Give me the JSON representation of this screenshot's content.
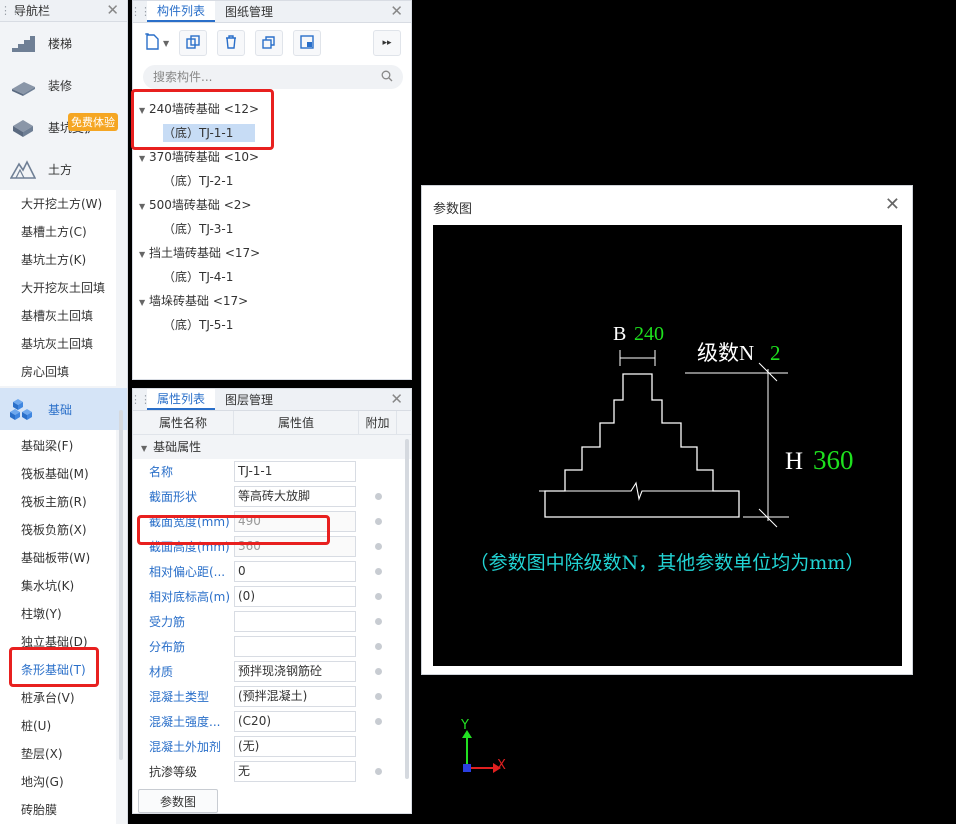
{
  "nav": {
    "title": "导航栏",
    "categories_top": [
      {
        "label": "楼梯",
        "icon": "stairs-icon"
      },
      {
        "label": "装修",
        "icon": "decoration-icon"
      },
      {
        "label": "基坑支护",
        "icon": "pit-support-icon"
      },
      {
        "label": "土方",
        "icon": "earthwork-icon"
      }
    ],
    "promo_badge": "免费体验",
    "earthwork_items": [
      "大开挖土方(W)",
      "基槽土方(C)",
      "基坑土方(K)",
      "大开挖灰土回填",
      "基槽灰土回填",
      "基坑灰土回填",
      "房心回填"
    ],
    "foundation_category": "基础",
    "foundation_items": [
      "基础梁(F)",
      "筏板基础(M)",
      "筏板主筋(R)",
      "筏板负筋(X)",
      "基础板带(W)",
      "集水坑(K)",
      "柱墩(Y)",
      "独立基础(D)",
      "条形基础(T)",
      "桩承台(V)",
      "桩(U)",
      "垫层(X)",
      "地沟(G)",
      "砖胎膜"
    ],
    "selected_item": "条形基础(T)"
  },
  "components": {
    "tabs": [
      "构件列表",
      "图纸管理"
    ],
    "search_placeholder": "搜索构件...",
    "groups": [
      {
        "label": "240墙砖基础 <12>",
        "leaf": "（底）TJ-1-1"
      },
      {
        "label": "370墙砖基础 <10>",
        "leaf": "（底）TJ-2-1"
      },
      {
        "label": "500墙砖基础 <2>",
        "leaf": "（底）TJ-3-1"
      },
      {
        "label": "挡土墙砖基础 <17>",
        "leaf": "（底）TJ-4-1"
      },
      {
        "label": "墙垛砖基础 <17>",
        "leaf": "（底）TJ-5-1"
      }
    ]
  },
  "properties": {
    "tabs": [
      "属性列表",
      "图层管理"
    ],
    "headers": [
      "属性名称",
      "属性值",
      "附加"
    ],
    "section": "基础属性",
    "rows": [
      {
        "name": "名称",
        "value": "TJ-1-1"
      },
      {
        "name": "截面形状",
        "value": "等高砖大放脚"
      },
      {
        "name": "截面宽度(mm)",
        "value": "490"
      },
      {
        "name": "截面高度(mm)",
        "value": "360"
      },
      {
        "name": "相对偏心距(...",
        "value": "0"
      },
      {
        "name": "相对底标高(m)",
        "value": "(0)"
      },
      {
        "name": "受力筋",
        "value": ""
      },
      {
        "name": "分布筋",
        "value": ""
      },
      {
        "name": "材质",
        "value": "预拌现浇钢筋砼"
      },
      {
        "name": "混凝土类型",
        "value": "(预拌混凝土)"
      },
      {
        "name": "混凝土强度...",
        "value": "(C20)"
      },
      {
        "name": "混凝土外加剂",
        "value": "(无)"
      },
      {
        "name": "抗渗等级",
        "value": "无"
      }
    ],
    "param_button": "参数图"
  },
  "dialog": {
    "title": "参数图",
    "b_label": "B",
    "b_value": "240",
    "n_label": "级数N",
    "n_value": "2",
    "h_label": "H",
    "h_value": "360",
    "note": "（参数图中除级数N，其他参数单位均为mm）"
  },
  "axes": {
    "y": "Y",
    "x": "X"
  },
  "colors": {
    "accent": "#2a6fc9",
    "highlight": "#e8201f",
    "param_value": "#1ee01e",
    "note": "#22d3d3"
  }
}
